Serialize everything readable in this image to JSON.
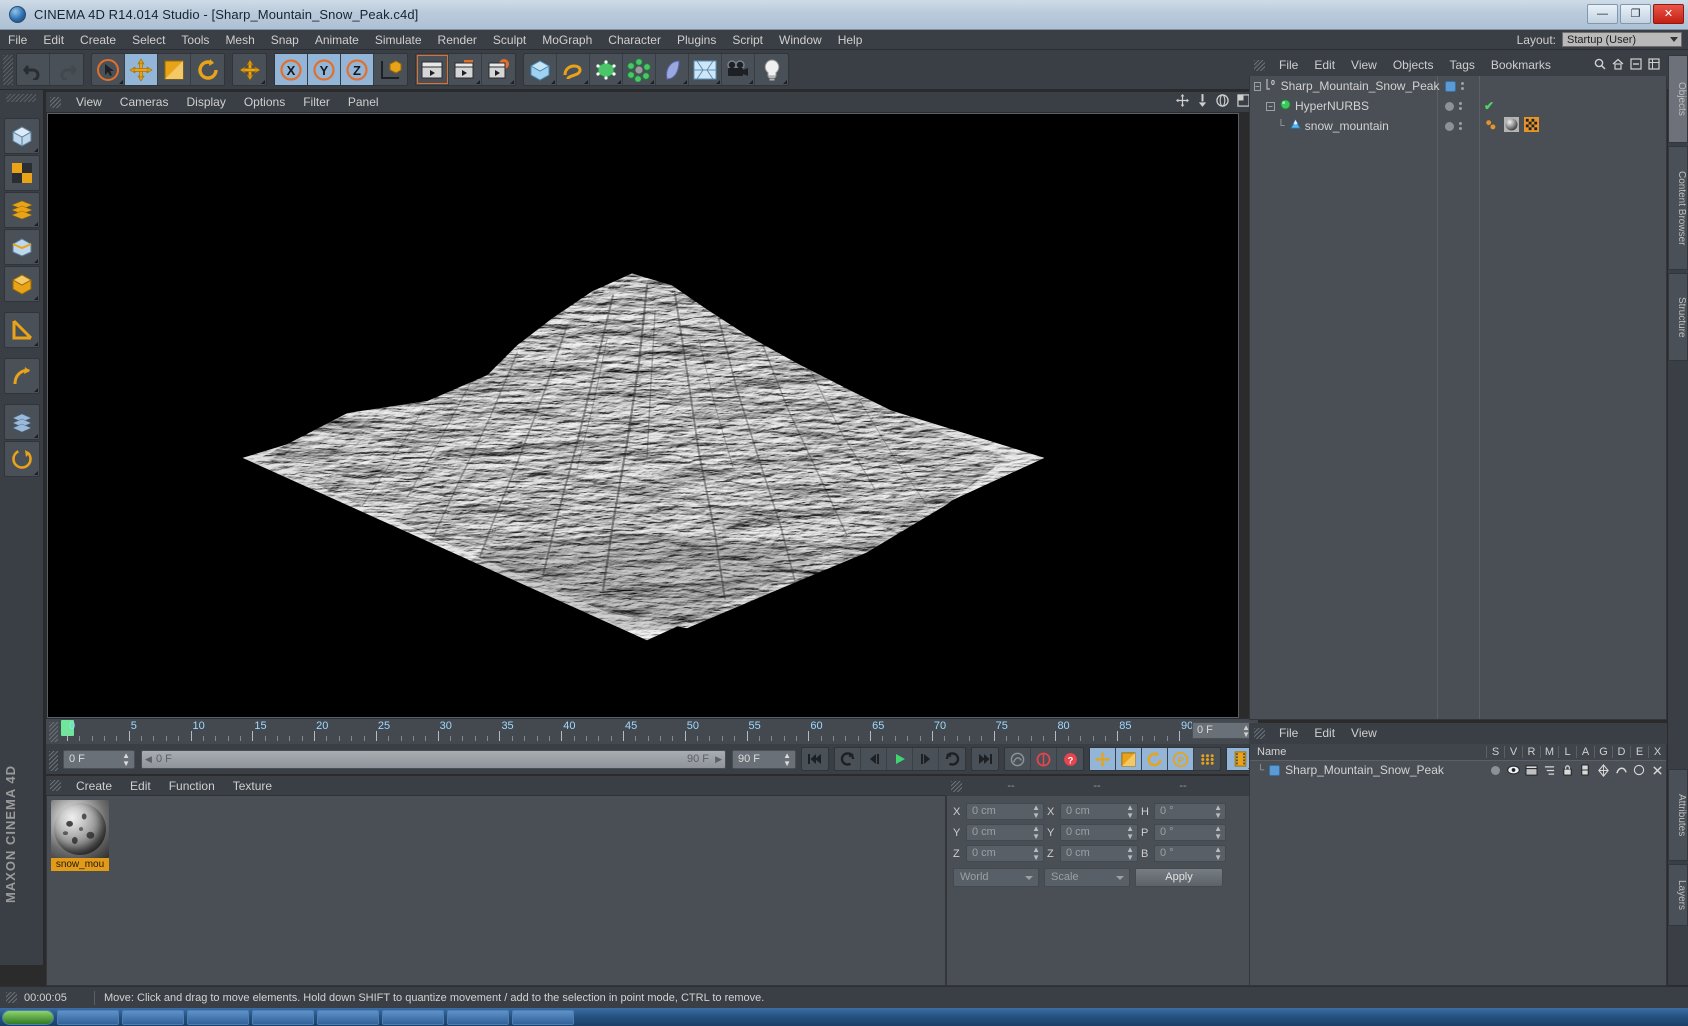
{
  "window": {
    "title": "CINEMA 4D R14.014 Studio - [Sharp_Mountain_Snow_Peak.c4d]",
    "app_icon": "c4d-logo-icon",
    "minimize": "—",
    "maximize": "❐",
    "close": "✕"
  },
  "menubar": {
    "items": [
      {
        "label": "File"
      },
      {
        "label": "Edit"
      },
      {
        "label": "Create"
      },
      {
        "label": "Select"
      },
      {
        "label": "Tools"
      },
      {
        "label": "Mesh"
      },
      {
        "label": "Snap"
      },
      {
        "label": "Animate"
      },
      {
        "label": "Simulate"
      },
      {
        "label": "Render"
      },
      {
        "label": "Sculpt"
      },
      {
        "label": "MoGraph"
      },
      {
        "label": "Character"
      },
      {
        "label": "Plugins"
      },
      {
        "label": "Script"
      },
      {
        "label": "Window"
      },
      {
        "label": "Help"
      }
    ],
    "layout_label": "Layout:",
    "layout_value": "Startup (User)"
  },
  "toolbar": {
    "groups": [
      {
        "name": "undo-redo",
        "buttons": [
          {
            "name": "undo-button",
            "icon": "undo-arrow-icon",
            "selected": false
          },
          {
            "name": "redo-button",
            "icon": "redo-arrow-icon",
            "selected": false
          }
        ]
      },
      {
        "name": "transform-tools",
        "buttons": [
          {
            "name": "live-selection-button",
            "icon": "cursor-select-icon",
            "selected": false
          },
          {
            "name": "move-tool-button",
            "icon": "move-arrows-icon",
            "selected": true
          },
          {
            "name": "scale-tool-button",
            "icon": "scale-box-icon",
            "selected": false
          },
          {
            "name": "rotate-tool-button",
            "icon": "rotate-circle-icon",
            "selected": false
          }
        ]
      },
      {
        "name": "world-axis",
        "buttons": [
          {
            "name": "world-coordinates-button",
            "icon": "plus-axis-icon",
            "selected": false
          }
        ]
      },
      {
        "name": "axis-locks",
        "buttons": [
          {
            "name": "lock-x-axis-button",
            "icon": "x-axis-icon",
            "selected": true
          },
          {
            "name": "lock-y-axis-button",
            "icon": "y-axis-icon",
            "selected": true
          },
          {
            "name": "lock-z-axis-button",
            "icon": "z-axis-icon",
            "selected": true
          },
          {
            "name": "world-object-toggle-button",
            "icon": "world-cube-icon",
            "selected": false
          }
        ]
      },
      {
        "name": "render-tools",
        "buttons": [
          {
            "name": "render-view-button",
            "icon": "clapperboard-icon",
            "selected": false
          },
          {
            "name": "render-region-button",
            "icon": "clapperboard-region-icon",
            "selected": false
          },
          {
            "name": "render-settings-button",
            "icon": "clapperboard-gear-icon",
            "selected": false
          }
        ]
      },
      {
        "name": "object-creation",
        "buttons": [
          {
            "name": "add-cube-button",
            "icon": "cube-icon",
            "selected": false
          },
          {
            "name": "add-spline-button",
            "icon": "spline-icon",
            "selected": false
          },
          {
            "name": "add-nurbs-button",
            "icon": "hypernurbs-cube-icon",
            "selected": false
          },
          {
            "name": "add-array-button",
            "icon": "array-icon",
            "selected": false
          },
          {
            "name": "add-deformer-button",
            "icon": "bend-deformer-icon",
            "selected": false
          },
          {
            "name": "add-environment-button",
            "icon": "floor-environment-icon",
            "selected": false
          },
          {
            "name": "add-camera-button",
            "icon": "camera-icon",
            "selected": false
          },
          {
            "name": "add-light-button",
            "icon": "lightbulb-icon",
            "selected": false
          }
        ]
      }
    ]
  },
  "left_palette": {
    "buttons": [
      {
        "name": "model-mode-button",
        "icon": "model-cube-icon"
      },
      {
        "name": "texture-mode-button",
        "icon": "texture-checker-icon"
      },
      {
        "name": "points-mode-button",
        "icon": "points-mode-icon"
      },
      {
        "name": "edges-mode-button",
        "icon": "edges-mode-icon"
      },
      {
        "name": "polygons-mode-button",
        "icon": "polygons-mode-icon"
      },
      {
        "name": "object-axis-button",
        "icon": "object-axis-icon"
      },
      {
        "name": "workplane-button",
        "icon": "workplane-ruler-icon"
      },
      {
        "name": "enable-axis-button",
        "icon": "axis-modify-icon"
      },
      {
        "name": "lock-workplane-button",
        "icon": "lock-workplane-icon"
      },
      {
        "name": "viewport-solo-button",
        "icon": "viewport-solo-icon"
      }
    ],
    "brand": "MAXON\nCINEMA 4D"
  },
  "viewport": {
    "menu": [
      {
        "label": "View"
      },
      {
        "label": "Cameras"
      },
      {
        "label": "Display"
      },
      {
        "label": "Options"
      },
      {
        "label": "Filter"
      },
      {
        "label": "Panel"
      }
    ],
    "corner_icons": [
      {
        "name": "pan-view-icon"
      },
      {
        "name": "dolly-view-icon"
      },
      {
        "name": "orbit-view-icon"
      },
      {
        "name": "maximize-view-icon"
      }
    ],
    "scene_object": "snow_mountain",
    "background_color": "#000000"
  },
  "timeline": {
    "playhead_frame": 0,
    "frame_ticks": [
      0,
      5,
      10,
      15,
      20,
      25,
      30,
      35,
      40,
      45,
      50,
      55,
      60,
      65,
      70,
      75,
      80,
      85,
      90
    ],
    "ruler_end_value": "0 F",
    "current_frame_field": "0 F",
    "preview_min": "0 F",
    "preview_max": "90 F",
    "max_frame_field": "90 F",
    "controls": [
      {
        "name": "go-to-start-button",
        "icon": "skip-start-icon"
      },
      {
        "name": "go-to-prev-key-button",
        "icon": "prev-key-icon"
      },
      {
        "name": "step-back-button",
        "icon": "step-back-icon"
      },
      {
        "name": "play-button",
        "icon": "play-triangle-icon"
      },
      {
        "name": "step-forward-button",
        "icon": "step-forward-icon"
      },
      {
        "name": "go-to-next-key-button",
        "icon": "next-key-icon"
      },
      {
        "name": "go-to-end-button",
        "icon": "skip-end-icon"
      },
      {
        "name": "record-active-objects-button",
        "icon": "record-dot-icon"
      },
      {
        "name": "autokeying-button",
        "icon": "autokey-icon"
      },
      {
        "name": "keyframe-selection-button",
        "icon": "question-mark-icon"
      },
      {
        "name": "position-key-button",
        "icon": "move-arrows-icon"
      },
      {
        "name": "scale-key-button",
        "icon": "scale-box-icon"
      },
      {
        "name": "rotation-key-button",
        "icon": "rotate-circle-icon"
      },
      {
        "name": "param-key-button",
        "icon": "p-circle-icon"
      },
      {
        "name": "pla-key-button",
        "icon": "point-grid-icon"
      },
      {
        "name": "timeline-filmstrip-button",
        "icon": "filmstrip-icon"
      }
    ]
  },
  "material_manager": {
    "menu": [
      {
        "label": "Create"
      },
      {
        "label": "Edit"
      },
      {
        "label": "Function"
      },
      {
        "label": "Texture"
      }
    ],
    "materials": [
      {
        "name": "snow_mou",
        "icon": "material-sphere-icon"
      }
    ]
  },
  "coordinates": {
    "headers": [
      "--",
      "--",
      "--"
    ],
    "rows": [
      {
        "pos_label": "X",
        "pos_value": "0 cm",
        "size_label": "X",
        "size_value": "0 cm",
        "rot_label": "H",
        "rot_value": "0 °"
      },
      {
        "pos_label": "Y",
        "pos_value": "0 cm",
        "size_label": "Y",
        "size_value": "0 cm",
        "rot_label": "P",
        "rot_value": "0 °"
      },
      {
        "pos_label": "Z",
        "pos_value": "0 cm",
        "size_label": "Z",
        "size_value": "0 cm",
        "rot_label": "B",
        "rot_value": "0 °"
      }
    ],
    "system_dropdown": "World",
    "mode_dropdown": "Scale",
    "apply_label": "Apply"
  },
  "object_manager": {
    "menu": [
      {
        "label": "File"
      },
      {
        "label": "Edit"
      },
      {
        "label": "View"
      },
      {
        "label": "Objects"
      },
      {
        "label": "Tags"
      },
      {
        "label": "Bookmarks"
      }
    ],
    "tools": [
      {
        "name": "search-icon"
      },
      {
        "name": "home-icon"
      },
      {
        "name": "collapse-icon"
      },
      {
        "name": "options-icon"
      }
    ],
    "tree": [
      {
        "label": "Sharp_Mountain_Snow_Peak",
        "icon": "layer-zero-icon",
        "depth": 0,
        "expandable": true,
        "visible_dot": "blue-square"
      },
      {
        "label": "HyperNURBS",
        "icon": "hypernurbs-green-icon",
        "depth": 1,
        "expandable": true,
        "visible_dot": "gray-circle",
        "check": "✔"
      },
      {
        "label": "snow_mountain",
        "icon": "landscape-blue-icon",
        "depth": 2,
        "expandable": false,
        "visible_dot": "gray-circle",
        "tags": [
          "phong-tag-icon",
          "material-tag-icon",
          "texture-checker-tag-icon"
        ]
      }
    ]
  },
  "layer_manager": {
    "menu": [
      {
        "label": "File"
      },
      {
        "label": "Edit"
      },
      {
        "label": "View"
      }
    ],
    "columns": [
      "S",
      "V",
      "R",
      "M",
      "L",
      "A",
      "G",
      "D",
      "E",
      "X"
    ],
    "name_header": "Name",
    "rows": [
      {
        "label": "Sharp_Mountain_Snow_Peak",
        "color": "#5b9bd5",
        "icons": [
          "solo-dot-icon",
          "eye-icon",
          "render-icon",
          "manager-icon",
          "lock-icon",
          "animation-icon",
          "generator-icon",
          "deformer-icon",
          "expression-icon",
          "xref-icon"
        ]
      }
    ]
  },
  "right_tabs": [
    {
      "label": "Objects"
    },
    {
      "label": "Content Browser"
    },
    {
      "label": "Structure"
    },
    {
      "label": "Attributes"
    },
    {
      "label": "Layers"
    }
  ],
  "statusbar": {
    "time": "00:00:05",
    "message": "Move: Click and drag to move elements. Hold down SHIFT to quantize movement / add to the selection in point mode, CTRL to remove."
  },
  "taskbar": {
    "start_label": "",
    "items": [
      "",
      "",
      "",
      "",
      "",
      "",
      "",
      "",
      ""
    ]
  },
  "colors": {
    "accent_orange": "#e39a16",
    "selection_blue": "#93b5d8",
    "panel_bg": "#3a3f45",
    "field_bg": "#595f66",
    "green_check": "#4fd46a",
    "timeline_green": "#6ee79a"
  }
}
